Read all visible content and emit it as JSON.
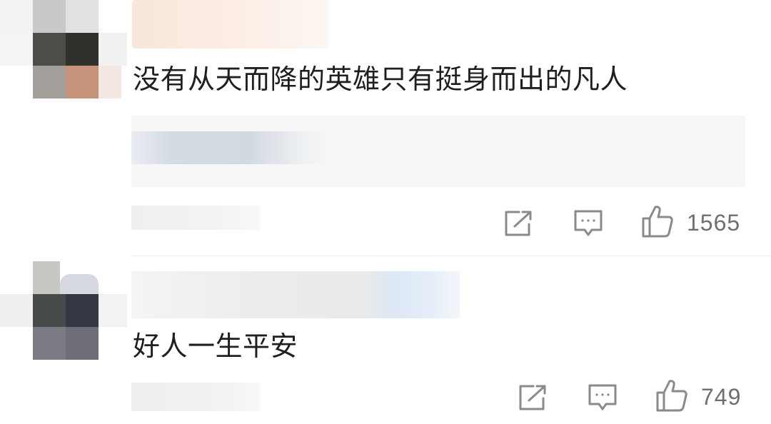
{
  "comments": [
    {
      "text": "没有从天而降的英雄只有挺身而出的凡人",
      "actions": {
        "share_icon": "share-icon",
        "reply_icon": "comment-icon",
        "like_icon": "thumbs-up-icon",
        "like_count": "1565"
      }
    },
    {
      "text": "好人一生平安",
      "actions": {
        "share_icon": "share-icon",
        "reply_icon": "comment-icon",
        "like_icon": "thumbs-up-icon",
        "like_count": "749"
      }
    }
  ],
  "colors": {
    "icon": "#8a8a8a",
    "count": "#6f6f6f",
    "text": "#1f1f1f"
  }
}
